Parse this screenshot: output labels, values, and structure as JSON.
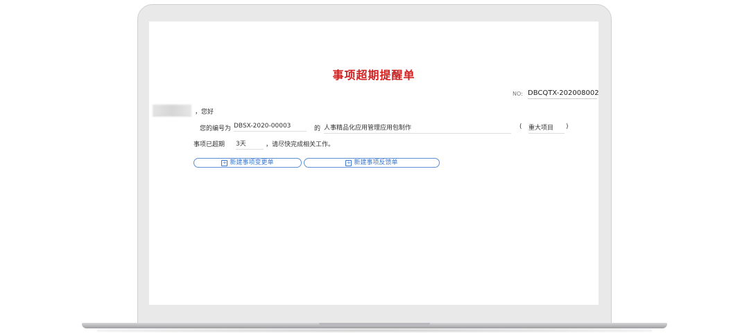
{
  "form": {
    "title": "事项超期提醒单",
    "no_label": "NO:",
    "no_value": "DBCQTX-202008002",
    "greeting": "，您好",
    "id_prefix": "您的编号为",
    "id_value": "DBSX-2020-00003",
    "de": "的",
    "item_name": "人事精品化应用管理应用包制作",
    "paren_open": "(",
    "category": "重大项目",
    "paren_close": ")",
    "overdue_label": "事项已超期",
    "overdue_value": "3天",
    "overdue_suffix": "，请尽快完成相关工作。"
  },
  "buttons": {
    "change": "新建事项变更单",
    "feedback": "新建事项反馈单"
  },
  "colors": {
    "title": "#d01f1f",
    "button_border": "#5b8fd6"
  }
}
